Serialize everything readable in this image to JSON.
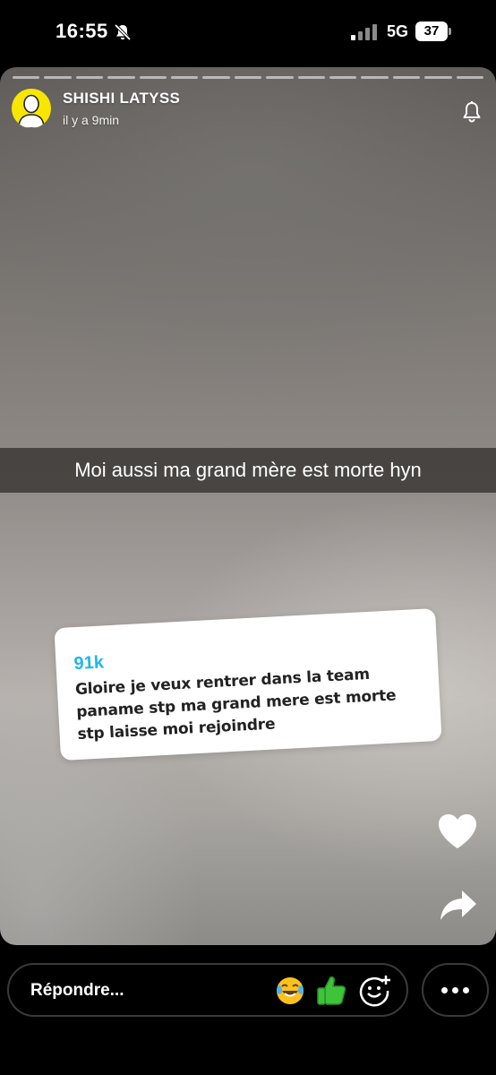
{
  "status_bar": {
    "time": "16:55",
    "network": "5G",
    "battery": "37"
  },
  "story": {
    "username": "SHISHI LATYSS",
    "time_ago": "il y a 9min",
    "caption": "Moi aussi ma grand mère est morte hyn",
    "reply_card": {
      "count": "91k",
      "text": "Gloire je veux rentrer dans la team paname stp ma grand mere est morte stp laisse moi rejoindre"
    },
    "progress_segments": 15,
    "colors": {
      "avatar": "#f7e600",
      "reply_count": "#1fb8ea"
    }
  },
  "bottom_bar": {
    "reply_placeholder": "Répondre...",
    "icons": [
      "laughing-emoji-icon",
      "thumbs-up-emoji-icon",
      "add-reaction-icon",
      "more-options-icon"
    ]
  }
}
